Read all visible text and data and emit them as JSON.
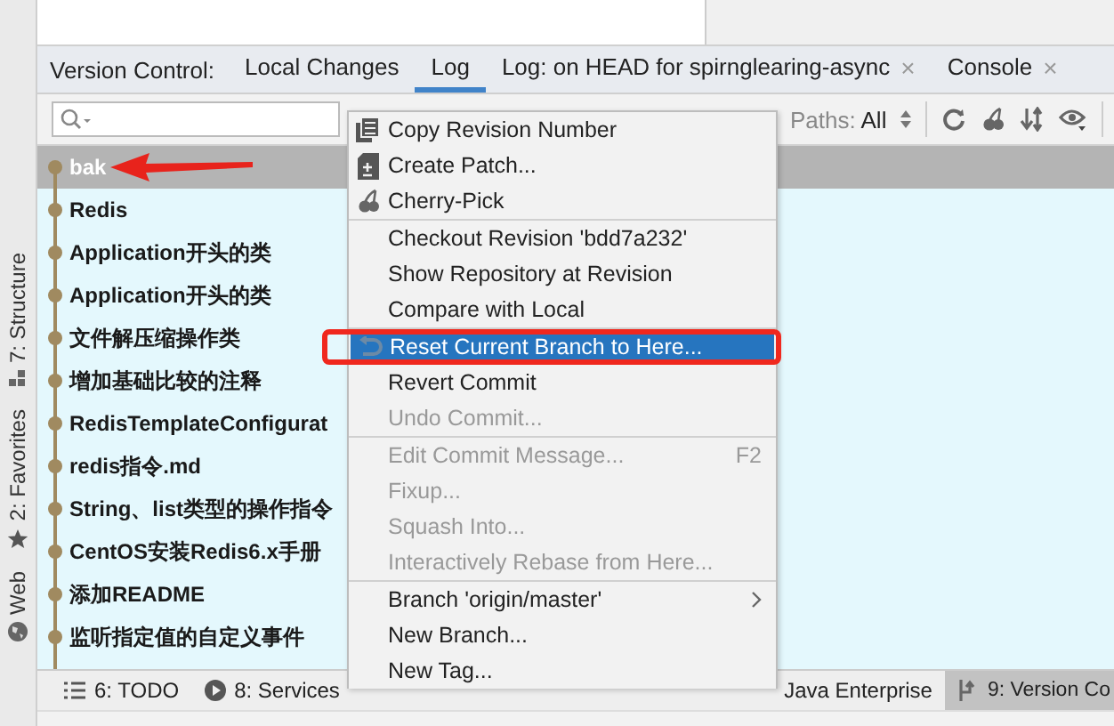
{
  "side_stripe": [
    "7: Structure",
    "2: Favorites",
    "Web"
  ],
  "tool_window": {
    "title": "Version Control:",
    "tabs": [
      {
        "label": "Local Changes",
        "selected": false
      },
      {
        "label": "Log",
        "selected": true
      },
      {
        "label": "Log: on HEAD for spirnglearing-async",
        "close": "×",
        "selected": false
      },
      {
        "label": "Console",
        "close": "×",
        "selected": false
      }
    ]
  },
  "filters": [
    {
      "label": "Paths:",
      "value": "All"
    }
  ],
  "commits": [
    {
      "message": "bak",
      "selected": true
    },
    {
      "message": "Redis",
      "selected": false
    },
    {
      "message": "Application开头的类",
      "selected": false
    },
    {
      "message": "Application开头的类",
      "selected": false
    },
    {
      "message": "文件解压缩操作类",
      "selected": false
    },
    {
      "message": "增加基础比较的注释",
      "selected": false
    },
    {
      "message": "RedisTemplateConfigurat",
      "selected": false
    },
    {
      "message": "redis指令.md",
      "selected": false
    },
    {
      "message": "String、list类型的操作指令",
      "selected": false
    },
    {
      "message": "CentOS安装Redis6.x手册",
      "selected": false
    },
    {
      "message": "添加README",
      "selected": false
    },
    {
      "message": "监听指定值的自定义事件",
      "selected": false
    }
  ],
  "bottom_tabs": [
    {
      "label": "6: TODO",
      "selected": false
    },
    {
      "label": "8: Services",
      "selected": false
    },
    {
      "label": "Java Enterprise",
      "selected": false
    },
    {
      "label": "9: Version Co",
      "selected": true
    }
  ],
  "context_menu": [
    {
      "kind": "item",
      "label": "Copy Revision Number",
      "disabled": false,
      "selected": false
    },
    {
      "kind": "item",
      "label": "Create Patch...",
      "disabled": false,
      "selected": false
    },
    {
      "kind": "item",
      "label": "Cherry-Pick",
      "disabled": false,
      "selected": false
    },
    {
      "kind": "separator"
    },
    {
      "kind": "item",
      "label": "Checkout Revision 'bdd7a232'",
      "disabled": false,
      "selected": false
    },
    {
      "kind": "item",
      "label": "Show Repository at Revision",
      "disabled": false,
      "selected": false
    },
    {
      "kind": "item",
      "label": "Compare with Local",
      "disabled": false,
      "selected": false
    },
    {
      "kind": "separator"
    },
    {
      "kind": "item",
      "label": "Reset Current Branch to Here...",
      "disabled": false,
      "selected": true
    },
    {
      "kind": "item",
      "label": "Revert Commit",
      "disabled": false,
      "selected": false
    },
    {
      "kind": "item",
      "label": "Undo Commit...",
      "disabled": true,
      "selected": false
    },
    {
      "kind": "separator"
    },
    {
      "kind": "item",
      "label": "Edit Commit Message...",
      "shortcut": "F2",
      "disabled": true,
      "selected": false
    },
    {
      "kind": "item",
      "label": "Fixup...",
      "disabled": true,
      "selected": false
    },
    {
      "kind": "item",
      "label": "Squash Into...",
      "disabled": true,
      "selected": false
    },
    {
      "kind": "item",
      "label": "Interactively Rebase from Here...",
      "disabled": true,
      "selected": false
    },
    {
      "kind": "separator"
    },
    {
      "kind": "item",
      "label": "Branch 'origin/master'",
      "submenu": true,
      "disabled": false,
      "selected": false
    },
    {
      "kind": "item",
      "label": "New Branch...",
      "disabled": false,
      "selected": false
    },
    {
      "kind": "item",
      "label": "New Tag...",
      "disabled": false,
      "selected": false
    }
  ]
}
